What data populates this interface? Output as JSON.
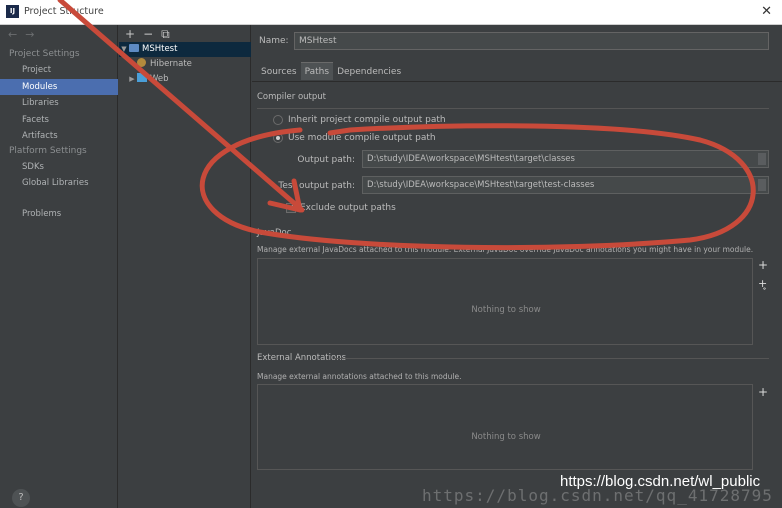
{
  "window": {
    "title": "Project Structure",
    "app_icon": "IJ",
    "close_glyph": "✕"
  },
  "nav": {
    "back": "←",
    "forward": "→"
  },
  "sidebar": {
    "project_settings_header": "Project Settings",
    "project_items": [
      "Project",
      "Modules",
      "Libraries",
      "Facets",
      "Artifacts"
    ],
    "selected_item": "Modules",
    "platform_settings_header": "Platform Settings",
    "platform_items": [
      "SDKs",
      "Global Libraries"
    ],
    "problems": "Problems",
    "help": "?"
  },
  "tree": {
    "toolbar": {
      "add": "+",
      "remove": "−",
      "copy": "⧉"
    },
    "module": "MSHtest",
    "children": [
      "Hibernate",
      "Web"
    ]
  },
  "module_editor": {
    "name_label": "Name:",
    "name_value": "MSHtest",
    "tabs": [
      "Sources",
      "Paths",
      "Dependencies"
    ],
    "active_tab": "Paths",
    "compiler_output": {
      "title": "Compiler output",
      "inherit_label": "Inherit project compile output path",
      "use_module_label": "Use module compile output path",
      "selected": "use_module",
      "output_path_label": "Output path:",
      "output_path_value": "D:\\study\\IDEA\\workspace\\MSHtest\\target\\classes",
      "test_output_path_label": "Test output path:",
      "test_output_path_value": "D:\\study\\IDEA\\workspace\\MSHtest\\target\\test-classes",
      "exclude_label": "Exclude output paths",
      "exclude_checked": true
    },
    "javadoc": {
      "title": "JavaDoc",
      "description": "Manage external JavaDocs attached to this module. External JavaDoc override JavaDoc annotations you might have in your module.",
      "empty_text": "Nothing to show"
    },
    "external_annotations": {
      "title": "External Annotations",
      "description": "Manage external annotations attached to this module.",
      "empty_text": "Nothing to show"
    }
  },
  "overlay": {
    "watermark": "https://blog.csdn.net/qq_41728795",
    "url_text": "https://blog.csdn.net/wl_public",
    "annotation_color": "#c84a3a"
  }
}
